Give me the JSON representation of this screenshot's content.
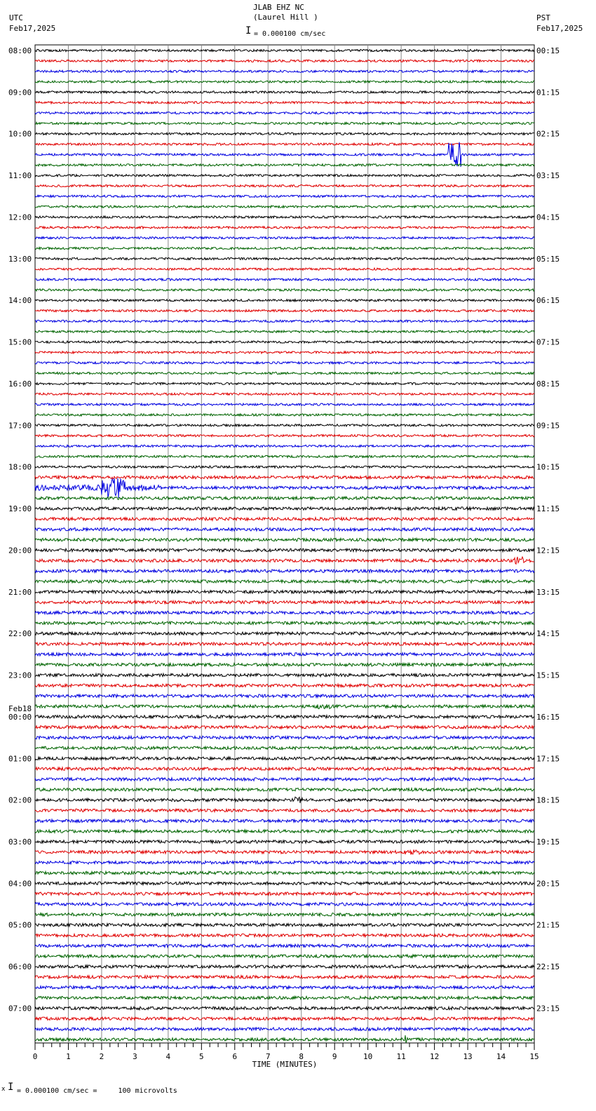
{
  "header": {
    "station": "JLAB EHZ NC",
    "location": "(Laurel Hill )",
    "left_tz": "UTC",
    "left_date": "Feb17,2025",
    "right_tz": "PST",
    "right_date": "Feb17,2025",
    "scale": "= 0.000100 cm/sec"
  },
  "footer": {
    "scale": "= 0.000100 cm/sec =     100 microvolts",
    "mark": "x"
  },
  "chart_data": {
    "type": "line",
    "title": "JLAB EHZ NC (Laurel Hill )",
    "xlabel": "TIME (MINUTES)",
    "xlim": [
      0,
      15
    ],
    "x_ticks": [
      "0",
      "1",
      "2",
      "3",
      "4",
      "5",
      "6",
      "7",
      "8",
      "9",
      "10",
      "11",
      "12",
      "13",
      "14",
      "15"
    ],
    "trace_count": 96,
    "trace_minutes": 15,
    "trace_colors": [
      "#000000",
      "#e00000",
      "#0000e0",
      "#006400"
    ],
    "left_labels": [
      "08:00",
      "09:00",
      "10:00",
      "11:00",
      "12:00",
      "13:00",
      "14:00",
      "15:00",
      "16:00",
      "17:00",
      "18:00",
      "19:00",
      "20:00",
      "21:00",
      "22:00",
      "23:00",
      "00:00",
      "01:00",
      "02:00",
      "03:00",
      "04:00",
      "05:00",
      "06:00",
      "07:00"
    ],
    "date_change_label": "Feb18",
    "date_change_index": 16,
    "right_labels": [
      "00:15",
      "01:15",
      "02:15",
      "03:15",
      "04:15",
      "05:15",
      "06:15",
      "07:15",
      "08:15",
      "09:15",
      "10:15",
      "11:15",
      "12:15",
      "13:15",
      "14:15",
      "15:15",
      "16:15",
      "17:15",
      "18:15",
      "19:15",
      "20:15",
      "21:15",
      "22:15",
      "23:15"
    ],
    "events": [
      {
        "trace": 10,
        "start_min": 12.4,
        "end_min": 12.8,
        "amplitude": 3.0
      },
      {
        "trace": 42,
        "start_min": 2.0,
        "end_min": 2.7,
        "amplitude": 2.6
      },
      {
        "trace": 42,
        "start_min": 0.0,
        "end_min": 3.8,
        "amplitude": 0.7
      },
      {
        "trace": 49,
        "start_min": 14.4,
        "end_min": 14.7,
        "amplitude": 1.0
      },
      {
        "trace": 72,
        "start_min": 7.8,
        "end_min": 8.2,
        "amplitude": 0.8
      },
      {
        "trace": 77,
        "start_min": 11.0,
        "end_min": 11.6,
        "amplitude": 0.6
      },
      {
        "trace": 63,
        "start_min": 8.4,
        "end_min": 8.9,
        "amplitude": 0.6
      },
      {
        "trace": 95,
        "start_min": 11.1,
        "end_min": 11.2,
        "amplitude": 1.2
      }
    ]
  }
}
